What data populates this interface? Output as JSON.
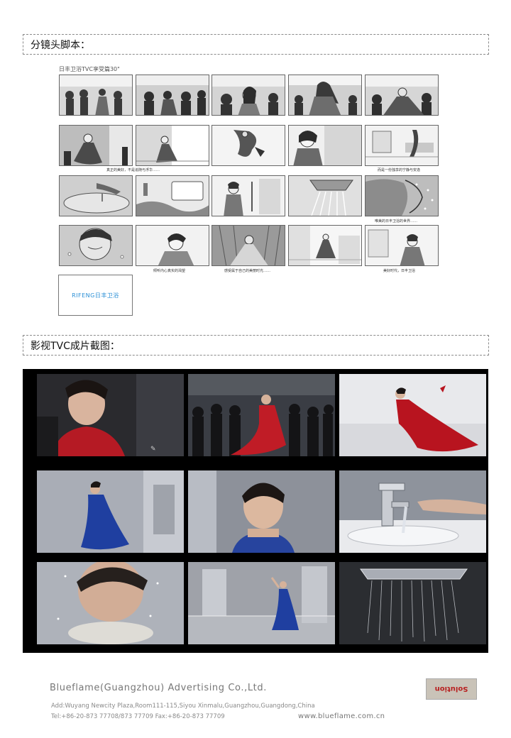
{
  "sections": {
    "storyboard_heading": "分镜头脚本：",
    "film_heading": "影视TVC成片截图："
  },
  "storyboard": {
    "title": "日丰卫浴TVC享受篇30\"",
    "captions": {
      "row2_left": "真正的美好，不是追随与浮华……",
      "row2_right": "而是一份独享的宁静与安逸",
      "row4_right_top": "唯美的日丰卫浴的世界……",
      "row4_b": "倾听内心真实的渴望",
      "row4_c": "感受属于自己的美丽时光……",
      "row4_e": "美好时代，日丰卫浴"
    },
    "logo_text": "RIFENG日丰卫浴"
  },
  "footer": {
    "company": "Blueflame(Guangzhou) Advertising Co.,Ltd.",
    "address": "Add:Wuyang Newcity Plaza,Room111-115,Siyou Xinmalu,Guangzhou,Guangdong,China",
    "phone": "Tel:+86-20-873 77708/873 77709    Fax:+86-20-873 77709",
    "website": "www.blueflame.com.cn",
    "badge": "Solution"
  },
  "colors": {
    "accent_red": "#b51a24",
    "accent_blue": "#1f3fa0",
    "logo_blue": "#2a8fd6"
  }
}
